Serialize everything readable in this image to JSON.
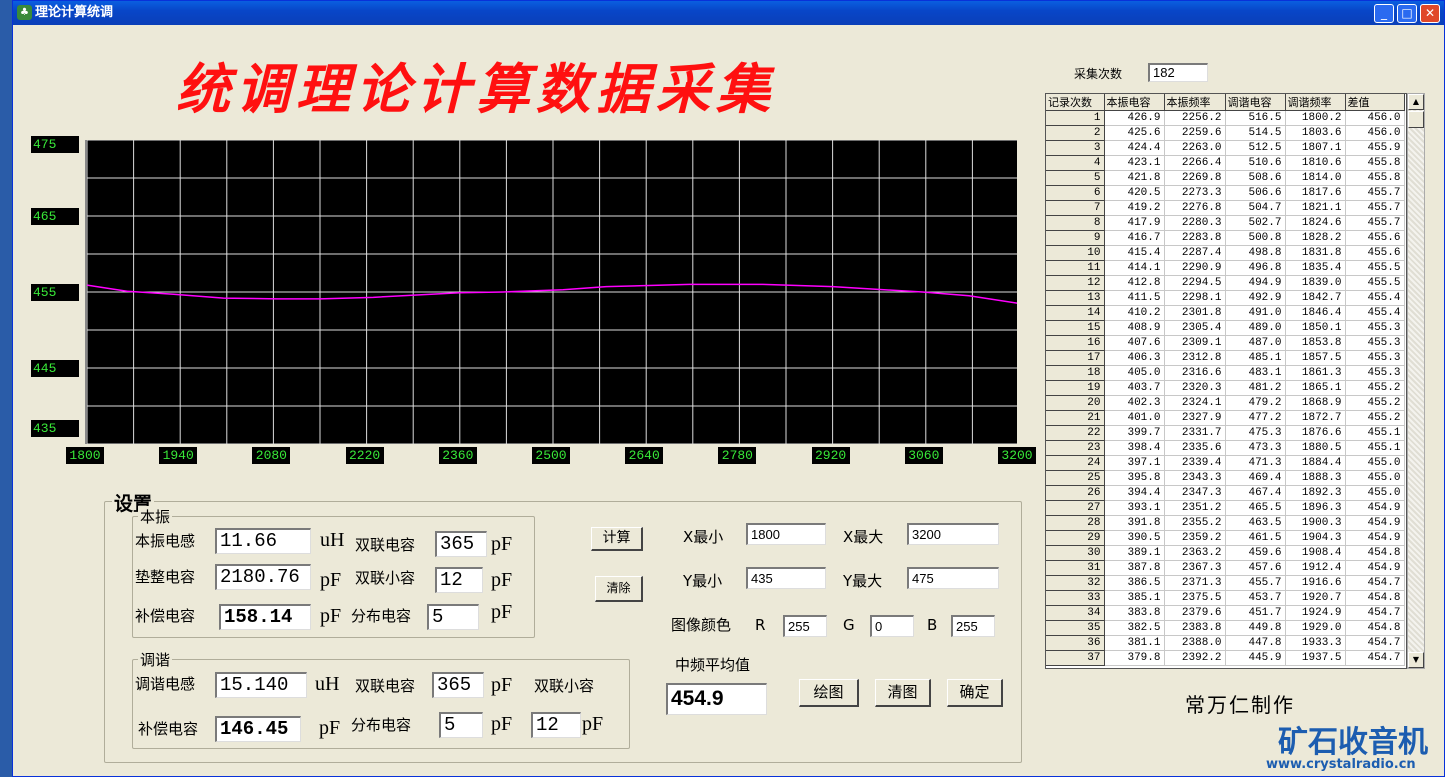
{
  "window": {
    "title": "理论计算统调",
    "min": "_",
    "max": "□",
    "close": "✕"
  },
  "heading": "统调理论计算数据采集",
  "chart_data": {
    "type": "line",
    "x_ticks": [
      1800,
      1940,
      2080,
      2220,
      2360,
      2500,
      2640,
      2780,
      2920,
      3060,
      3200
    ],
    "y_ticks": [
      475,
      465,
      455,
      445,
      435
    ],
    "xlim": [
      1800,
      3200
    ],
    "ylim": [
      435,
      475
    ],
    "grid": true,
    "line_color": "#ff00ff",
    "x": [
      1800,
      1860,
      1930,
      2005,
      2085,
      2150,
      2230,
      2360,
      2425,
      2515,
      2580,
      2705,
      2815,
      2920,
      3055,
      3125,
      3200
    ],
    "y": [
      455.9,
      455.1,
      454.7,
      454.2,
      454.1,
      454.1,
      454.3,
      454.9,
      455.0,
      455.3,
      455.7,
      456.0,
      456.0,
      455.7,
      455.0,
      454.5,
      453.5
    ]
  },
  "settings": {
    "label": "设置",
    "lo": {
      "label": "本振",
      "inductance_label": "本振电感",
      "inductance": "11.66",
      "uH": "uH",
      "cap_label": "双联电容",
      "cap": "365",
      "pF": "pF",
      "pad_label": "垫整电容",
      "pad": "2180.76",
      "small_label": "双联小容",
      "small": "12",
      "comp_label": "补偿电容",
      "comp": "158.14",
      "dist_label": "分布电容",
      "dist": "5"
    },
    "tune": {
      "label": "调谐",
      "inductance_label": "调谐电感",
      "inductance": "15.140",
      "uH": "uH",
      "cap_label": "双联电容",
      "cap": "365",
      "pF": "pF",
      "small_label": "双联小容",
      "small": "12",
      "comp_label": "补偿电容",
      "comp": "146.45",
      "dist_label": "分布电容",
      "dist": "5"
    },
    "calc_button": "计算",
    "clear_button": "清除",
    "xmin_label": "X最小",
    "xmin": "1800",
    "xmax_label": "X最大",
    "xmax": "3200",
    "ymin_label": "Y最小",
    "ymin": "435",
    "ymax_label": "Y最大",
    "ymax": "475",
    "color_label": "图像颜色",
    "r_label": "R",
    "r": "255",
    "g_label": "G",
    "g": "0",
    "b_label": "B",
    "b": "255",
    "avg_label": "中频平均值",
    "avg": "454.9",
    "plot_button": "绘图",
    "clear_plot_button": "清图",
    "ok_button": "确定"
  },
  "count_label": "采集次数",
  "count": "182",
  "table": {
    "columns": [
      "记录次数",
      "本振电容",
      "本振频率",
      "调谐电容",
      "调谐频率",
      "差值"
    ],
    "rows": [
      [
        "1",
        "426.9",
        "2256.2",
        "516.5",
        "1800.2",
        "456.0"
      ],
      [
        "2",
        "425.6",
        "2259.6",
        "514.5",
        "1803.6",
        "456.0"
      ],
      [
        "3",
        "424.4",
        "2263.0",
        "512.5",
        "1807.1",
        "455.9"
      ],
      [
        "4",
        "423.1",
        "2266.4",
        "510.6",
        "1810.6",
        "455.8"
      ],
      [
        "5",
        "421.8",
        "2269.8",
        "508.6",
        "1814.0",
        "455.8"
      ],
      [
        "6",
        "420.5",
        "2273.3",
        "506.6",
        "1817.6",
        "455.7"
      ],
      [
        "7",
        "419.2",
        "2276.8",
        "504.7",
        "1821.1",
        "455.7"
      ],
      [
        "8",
        "417.9",
        "2280.3",
        "502.7",
        "1824.6",
        "455.7"
      ],
      [
        "9",
        "416.7",
        "2283.8",
        "500.8",
        "1828.2",
        "455.6"
      ],
      [
        "10",
        "415.4",
        "2287.4",
        "498.8",
        "1831.8",
        "455.6"
      ],
      [
        "11",
        "414.1",
        "2290.9",
        "496.8",
        "1835.4",
        "455.5"
      ],
      [
        "12",
        "412.8",
        "2294.5",
        "494.9",
        "1839.0",
        "455.5"
      ],
      [
        "13",
        "411.5",
        "2298.1",
        "492.9",
        "1842.7",
        "455.4"
      ],
      [
        "14",
        "410.2",
        "2301.8",
        "491.0",
        "1846.4",
        "455.4"
      ],
      [
        "15",
        "408.9",
        "2305.4",
        "489.0",
        "1850.1",
        "455.3"
      ],
      [
        "16",
        "407.6",
        "2309.1",
        "487.0",
        "1853.8",
        "455.3"
      ],
      [
        "17",
        "406.3",
        "2312.8",
        "485.1",
        "1857.5",
        "455.3"
      ],
      [
        "18",
        "405.0",
        "2316.6",
        "483.1",
        "1861.3",
        "455.3"
      ],
      [
        "19",
        "403.7",
        "2320.3",
        "481.2",
        "1865.1",
        "455.2"
      ],
      [
        "20",
        "402.3",
        "2324.1",
        "479.2",
        "1868.9",
        "455.2"
      ],
      [
        "21",
        "401.0",
        "2327.9",
        "477.2",
        "1872.7",
        "455.2"
      ],
      [
        "22",
        "399.7",
        "2331.7",
        "475.3",
        "1876.6",
        "455.1"
      ],
      [
        "23",
        "398.4",
        "2335.6",
        "473.3",
        "1880.5",
        "455.1"
      ],
      [
        "24",
        "397.1",
        "2339.4",
        "471.3",
        "1884.4",
        "455.0"
      ],
      [
        "25",
        "395.8",
        "2343.3",
        "469.4",
        "1888.3",
        "455.0"
      ],
      [
        "26",
        "394.4",
        "2347.3",
        "467.4",
        "1892.3",
        "455.0"
      ],
      [
        "27",
        "393.1",
        "2351.2",
        "465.5",
        "1896.3",
        "454.9"
      ],
      [
        "28",
        "391.8",
        "2355.2",
        "463.5",
        "1900.3",
        "454.9"
      ],
      [
        "29",
        "390.5",
        "2359.2",
        "461.5",
        "1904.3",
        "454.9"
      ],
      [
        "30",
        "389.1",
        "2363.2",
        "459.6",
        "1908.4",
        "454.8"
      ],
      [
        "31",
        "387.8",
        "2367.3",
        "457.6",
        "1912.4",
        "454.9"
      ],
      [
        "32",
        "386.5",
        "2371.3",
        "455.7",
        "1916.6",
        "454.7"
      ],
      [
        "33",
        "385.1",
        "2375.5",
        "453.7",
        "1920.7",
        "454.8"
      ],
      [
        "34",
        "383.8",
        "2379.6",
        "451.7",
        "1924.9",
        "454.7"
      ],
      [
        "35",
        "382.5",
        "2383.8",
        "449.8",
        "1929.0",
        "454.8"
      ],
      [
        "36",
        "381.1",
        "2388.0",
        "447.8",
        "1933.3",
        "454.7"
      ],
      [
        "37",
        "379.8",
        "2392.2",
        "445.9",
        "1937.5",
        "454.7"
      ]
    ]
  },
  "author": "常万仁制作",
  "watermark": {
    "name": "矿石收音机",
    "url": "www.crystalradio.cn"
  }
}
